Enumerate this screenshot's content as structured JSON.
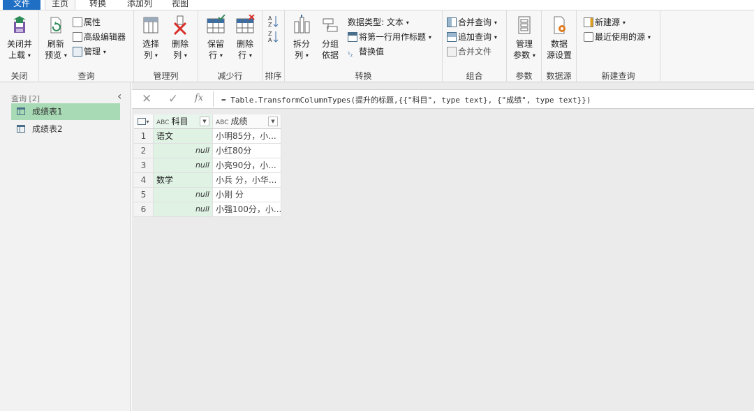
{
  "tabs": [
    {
      "label": "文件"
    },
    {
      "label": "主页"
    },
    {
      "label": "转换"
    },
    {
      "label": "添加列"
    },
    {
      "label": "视图"
    }
  ],
  "ribbon": {
    "close": {
      "btn_line1": "关闭并",
      "btn_line2": "上载",
      "group": "关闭"
    },
    "query": {
      "refresh_line1": "刷新",
      "refresh_line2": "预览",
      "properties": "属性",
      "advanced_editor": "高级编辑器",
      "manage": "管理",
      "group": "查询"
    },
    "manage_columns": {
      "choose_line1": "选择",
      "choose_line2": "列",
      "remove_line1": "删除",
      "remove_line2": "列",
      "group": "管理列"
    },
    "reduce_rows": {
      "keep_line1": "保留",
      "keep_line2": "行",
      "remove_line1": "删除",
      "remove_line2": "行",
      "group": "减少行"
    },
    "sort": {
      "group": "排序"
    },
    "transform": {
      "split_line1": "拆分",
      "split_line2": "列",
      "groupby_line1": "分组",
      "groupby_line2": "依据",
      "data_type": "数据类型: 文本",
      "first_row_headers": "将第一行用作标题",
      "replace_values": "替换值",
      "group": "转换"
    },
    "combine": {
      "merge_queries": "合并查询",
      "append_queries": "追加查询",
      "combine_files": "合并文件",
      "group": "组合"
    },
    "parameters": {
      "manage_line1": "管理",
      "manage_line2": "参数",
      "group": "参数"
    },
    "data_source": {
      "settings_line1": "数据",
      "settings_line2": "源设置",
      "group": "数据源"
    },
    "new_query": {
      "new_source": "新建源",
      "recent_sources": "最近使用的源",
      "group": "新建查询"
    }
  },
  "queries_pane": {
    "header": "查询 [2]",
    "items": [
      {
        "label": "成绩表1"
      },
      {
        "label": "成绩表2"
      }
    ]
  },
  "formula_bar": {
    "fx": "fx",
    "formula": "= Table.TransformColumnTypes(提升的标题,{{\"科目\", type text}, {\"成绩\", type text}})"
  },
  "table": {
    "type_label": "ABC",
    "columns": [
      "科目",
      "成绩"
    ],
    "rows": [
      {
        "num": "1",
        "subject": "语文",
        "score": "小明85分，小..."
      },
      {
        "num": "2",
        "subject": "null",
        "score": "小红80分"
      },
      {
        "num": "3",
        "subject": "null",
        "score": "小亮90分，小..."
      },
      {
        "num": "4",
        "subject": "数学",
        "score": "小兵 分，小华..."
      },
      {
        "num": "5",
        "subject": "null",
        "score": "小刚 分"
      },
      {
        "num": "6",
        "subject": "null",
        "score": "小强100分，小..."
      }
    ]
  },
  "colors": {
    "file_tab": "#1f6fc5",
    "selected_query": "#a8dbb5",
    "subject_column": "#dff2e4",
    "ribbon_bg": "#f7f7f7"
  }
}
